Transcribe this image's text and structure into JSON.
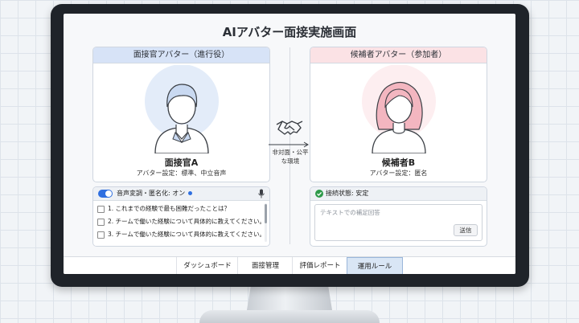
{
  "title": "AIアバター面接実施画面",
  "interviewer": {
    "header": "面接官アバター（進行役）",
    "name": "面接官A",
    "setting": "アバター設定：標準、中立音声",
    "accent_color": "#d7e3f7",
    "avatar_color": "#c9d9f1"
  },
  "candidate": {
    "header": "候補者アバター（参加者）",
    "name": "候補者B",
    "setting": "アバター設定：匿名",
    "accent_color": "#fbe2e5",
    "avatar_color": "#f3b6c0"
  },
  "center": {
    "icon": "handshake-icon",
    "label_line1": "非対面・公平",
    "label_line2": "な環境"
  },
  "voice_panel": {
    "toggle_label": "音声変調・匿名化: オン",
    "toggle_on": true,
    "questions": [
      "1. これまでの経験で最も困難だったことは？",
      "2. チームで働いた経験について具体的に教えてください。",
      "3. チームで働いた経験について具体的に教えてください。"
    ]
  },
  "status_panel": {
    "status_label": "接続状態: 安定",
    "status_color": "#2e9a4a",
    "input_placeholder": "テキストでの補足回答",
    "send_label": "送信"
  },
  "nav": {
    "items": [
      "ダッシュボード",
      "面接管理",
      "評価レポート",
      "運用ルール"
    ],
    "active": "運用ルール"
  }
}
